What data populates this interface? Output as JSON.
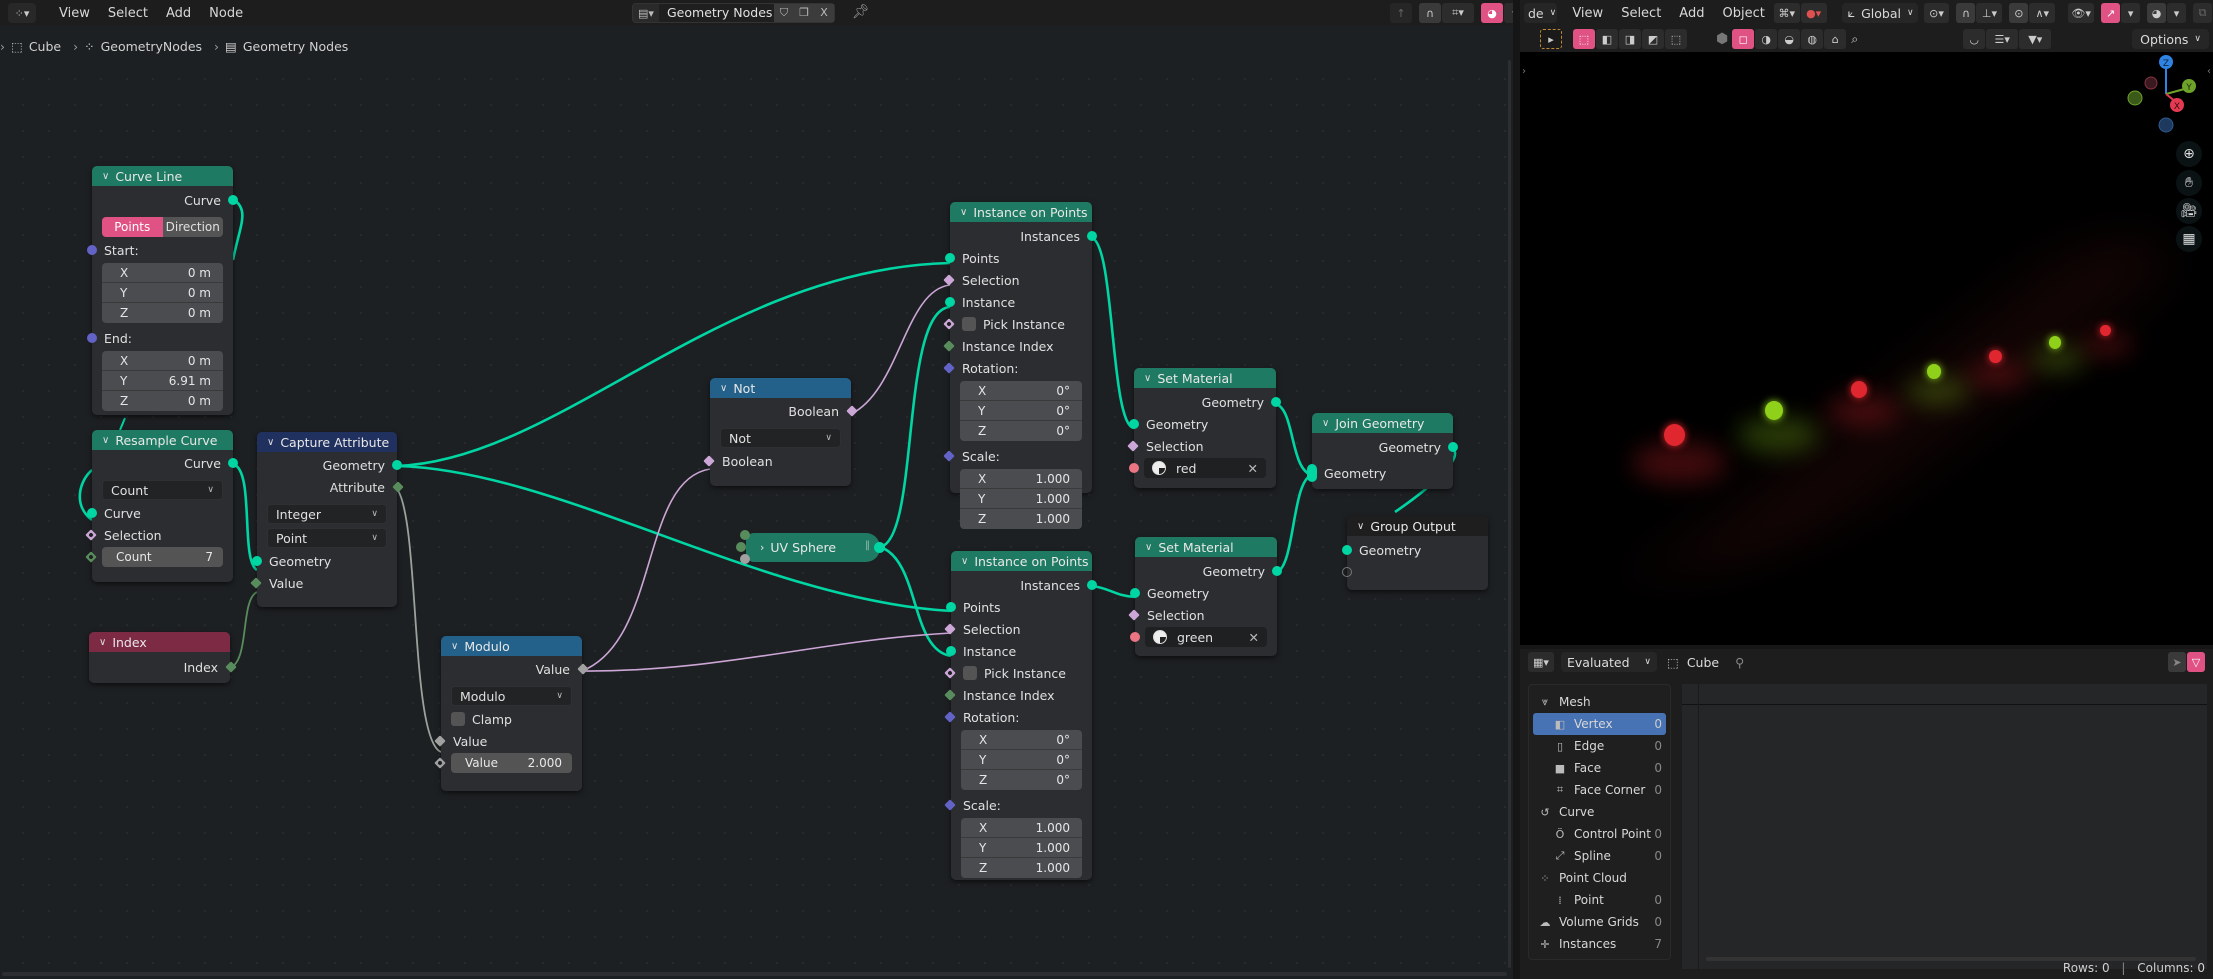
{
  "node_editor": {
    "header": {
      "editor_type_icon": "geometry-nodes-editor-icon",
      "menus": [
        "View",
        "Select",
        "Add",
        "Node"
      ],
      "node_tree_name": "Geometry Nodes",
      "fake_user_icon": "shield-icon",
      "duplicate_icon": "copy-icon",
      "unlink_label": "X",
      "pin_icon": "pin-icon"
    },
    "breadcrumb": [
      "Cube",
      "GeometryNodes",
      "Geometry Nodes"
    ],
    "nodes": {
      "curve_line": {
        "title": "Curve Line",
        "output": "Curve",
        "mode_options": [
          "Points",
          "Direction"
        ],
        "mode_selected": "Points",
        "start_label": "Start:",
        "start": [
          [
            "X",
            "0 m"
          ],
          [
            "Y",
            "0 m"
          ],
          [
            "Z",
            "0 m"
          ]
        ],
        "end_label": "End:",
        "end": [
          [
            "X",
            "0 m"
          ],
          [
            "Y",
            "6.91 m"
          ],
          [
            "Z",
            "0 m"
          ]
        ]
      },
      "resample_curve": {
        "title": "Resample Curve",
        "output": "Curve",
        "mode": "Count",
        "inputs": [
          "Curve",
          "Selection"
        ],
        "count_label": "Count",
        "count_value": "7"
      },
      "capture_attribute": {
        "title": "Capture Attribute",
        "outputs": [
          "Geometry",
          "Attribute"
        ],
        "data_type": "Integer",
        "domain": "Point",
        "inputs": [
          "Geometry",
          "Value"
        ]
      },
      "index": {
        "title": "Index",
        "output": "Index"
      },
      "modulo": {
        "title": "Modulo",
        "output": "Value",
        "operation": "Modulo",
        "clamp_label": "Clamp",
        "clamp_checked": false,
        "input_value_label": "Value",
        "field_label": "Value",
        "field_value": "2.000"
      },
      "not": {
        "title": "Not",
        "output": "Boolean",
        "operation": "Not",
        "input": "Boolean"
      },
      "uv_sphere": {
        "title": "UV Sphere"
      },
      "instance_on_points_1": {
        "title": "Instance on Points",
        "output": "Instances",
        "inputs": [
          "Points",
          "Selection",
          "Instance"
        ],
        "pick_instance_label": "Pick Instance",
        "instance_index_label": "Instance Index",
        "rotation_label": "Rotation:",
        "rotation": [
          [
            "X",
            "0°"
          ],
          [
            "Y",
            "0°"
          ],
          [
            "Z",
            "0°"
          ]
        ],
        "scale_label": "Scale:",
        "scale": [
          [
            "X",
            "1.000"
          ],
          [
            "Y",
            "1.000"
          ],
          [
            "Z",
            "1.000"
          ]
        ]
      },
      "instance_on_points_2": {
        "title": "Instance on Points",
        "output": "Instances",
        "inputs": [
          "Points",
          "Selection",
          "Instance"
        ],
        "pick_instance_label": "Pick Instance",
        "instance_index_label": "Instance Index",
        "rotation_label": "Rotation:",
        "rotation": [
          [
            "X",
            "0°"
          ],
          [
            "Y",
            "0°"
          ],
          [
            "Z",
            "0°"
          ]
        ],
        "scale_label": "Scale:",
        "scale": [
          [
            "X",
            "1.000"
          ],
          [
            "Y",
            "1.000"
          ],
          [
            "Z",
            "1.000"
          ]
        ]
      },
      "set_material_1": {
        "title": "Set Material",
        "output": "Geometry",
        "inputs": [
          "Geometry",
          "Selection"
        ],
        "material": "red"
      },
      "set_material_2": {
        "title": "Set Material",
        "output": "Geometry",
        "inputs": [
          "Geometry",
          "Selection"
        ],
        "material": "green"
      },
      "join_geometry": {
        "title": "Join Geometry",
        "output": "Geometry",
        "input": "Geometry"
      },
      "group_output": {
        "title": "Group Output",
        "input": "Geometry"
      }
    },
    "colors": {
      "geometry_socket": "#00d6a3",
      "header_geometry": "#1e7a62",
      "header_attribute": "#21315f",
      "header_input": "#7d2b45",
      "header_converter": "#23618a",
      "toggle_active": "#e05283"
    }
  },
  "viewport": {
    "header": {
      "mode_partial": "de",
      "menus": [
        "View",
        "Select",
        "Add",
        "Object"
      ],
      "orientation": "Global",
      "options_label": "Options"
    },
    "gizmo_axes": [
      "X",
      "Y",
      "Z"
    ],
    "spheres": [
      {
        "color": "red"
      },
      {
        "color": "green"
      },
      {
        "color": "red"
      },
      {
        "color": "green"
      },
      {
        "color": "red"
      },
      {
        "color": "green"
      },
      {
        "color": "red"
      }
    ],
    "colors": {
      "red_sphere": "#e0262e",
      "green_sphere": "#8fd11a"
    }
  },
  "spreadsheet": {
    "header": {
      "evaluation": "Evaluated",
      "object": "Cube"
    },
    "domains": [
      {
        "label": "Mesh",
        "icon": "mesh-icon",
        "level": 0
      },
      {
        "label": "Vertex",
        "icon": "vertex-icon",
        "level": 1,
        "count": "0",
        "selected": true
      },
      {
        "label": "Edge",
        "icon": "edge-icon",
        "level": 1,
        "count": "0"
      },
      {
        "label": "Face",
        "icon": "face-icon",
        "level": 1,
        "count": "0"
      },
      {
        "label": "Face Corner",
        "icon": "face-corner-icon",
        "level": 1,
        "count": "0"
      },
      {
        "label": "Curve",
        "icon": "curve-icon",
        "level": 0
      },
      {
        "label": "Control Point",
        "icon": "control-point-icon",
        "level": 1,
        "count": "0"
      },
      {
        "label": "Spline",
        "icon": "spline-icon",
        "level": 1,
        "count": "0"
      },
      {
        "label": "Point Cloud",
        "icon": "point-cloud-icon",
        "level": 0
      },
      {
        "label": "Point",
        "icon": "point-icon",
        "level": 1,
        "count": "0"
      },
      {
        "label": "Volume Grids",
        "icon": "volume-icon",
        "level": 0,
        "count": "0"
      },
      {
        "label": "Instances",
        "icon": "instances-icon",
        "level": 0,
        "count": "7"
      }
    ],
    "status": {
      "rows": "Rows: 0",
      "columns": "Columns: 0"
    }
  }
}
